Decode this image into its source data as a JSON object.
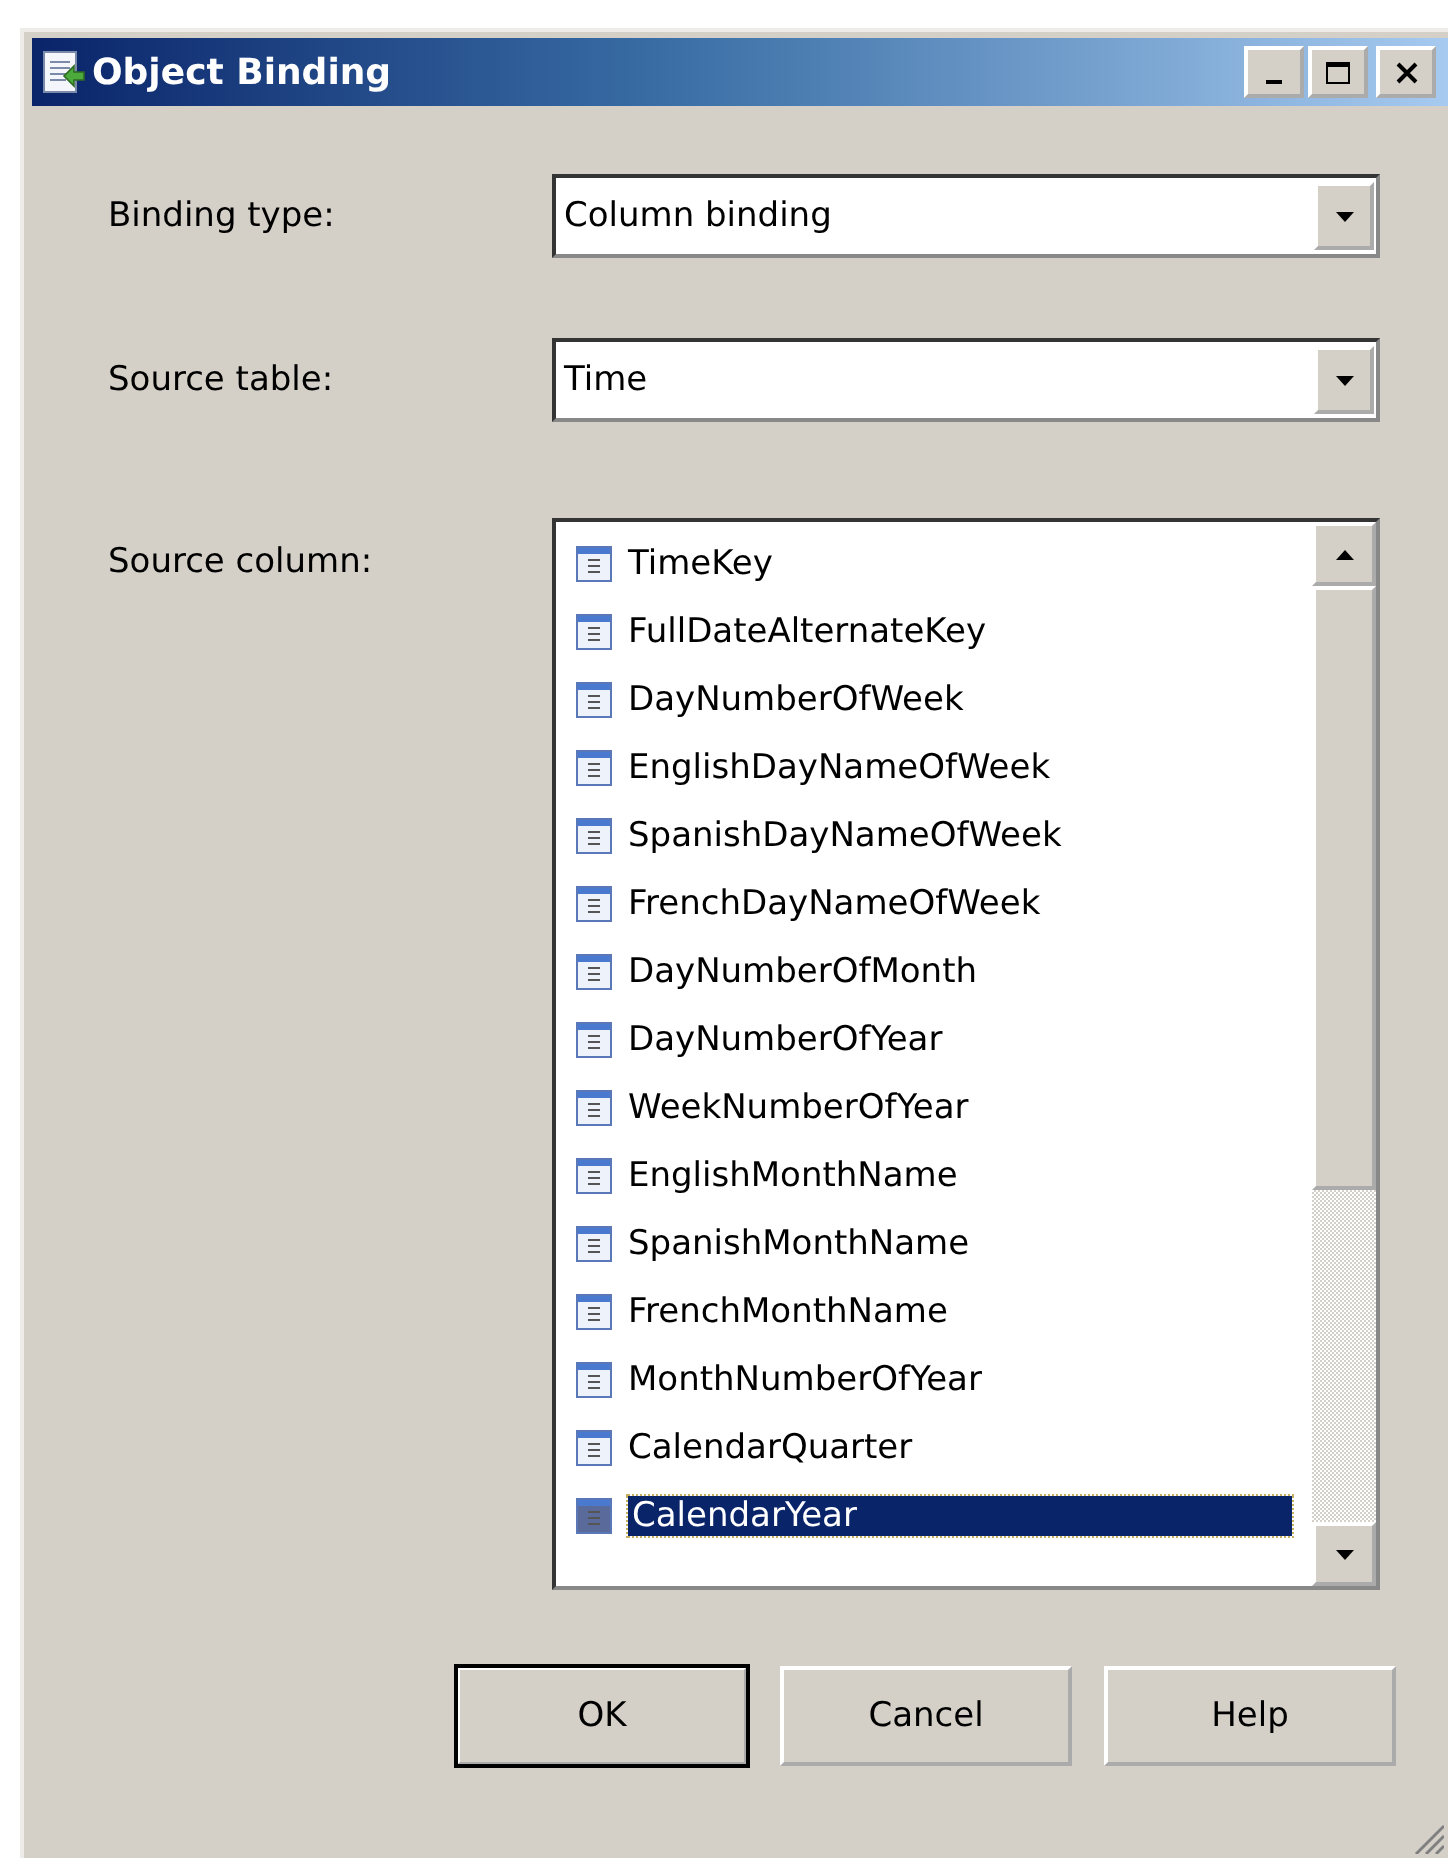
{
  "window": {
    "title": "Object Binding"
  },
  "fields": [
    {
      "label": "Binding type:",
      "value": "Column binding"
    },
    {
      "label": "Source table:",
      "value": "Time"
    }
  ],
  "source_column": {
    "label": "Source column:",
    "items": [
      {
        "text": "TimeKey",
        "selected": false
      },
      {
        "text": "FullDateAlternateKey",
        "selected": false
      },
      {
        "text": "DayNumberOfWeek",
        "selected": false
      },
      {
        "text": "EnglishDayNameOfWeek",
        "selected": false
      },
      {
        "text": "SpanishDayNameOfWeek",
        "selected": false
      },
      {
        "text": "FrenchDayNameOfWeek",
        "selected": false
      },
      {
        "text": "DayNumberOfMonth",
        "selected": false
      },
      {
        "text": "DayNumberOfYear",
        "selected": false
      },
      {
        "text": "WeekNumberOfYear",
        "selected": false
      },
      {
        "text": "EnglishMonthName",
        "selected": false
      },
      {
        "text": "SpanishMonthName",
        "selected": false
      },
      {
        "text": "FrenchMonthName",
        "selected": false
      },
      {
        "text": "MonthNumberOfYear",
        "selected": false
      },
      {
        "text": "CalendarQuarter",
        "selected": false
      },
      {
        "text": "CalendarYear",
        "selected": true
      }
    ]
  },
  "buttons": [
    {
      "label": "OK",
      "default": true
    },
    {
      "label": "Cancel",
      "default": false
    },
    {
      "label": "Help",
      "default": false
    }
  ]
}
